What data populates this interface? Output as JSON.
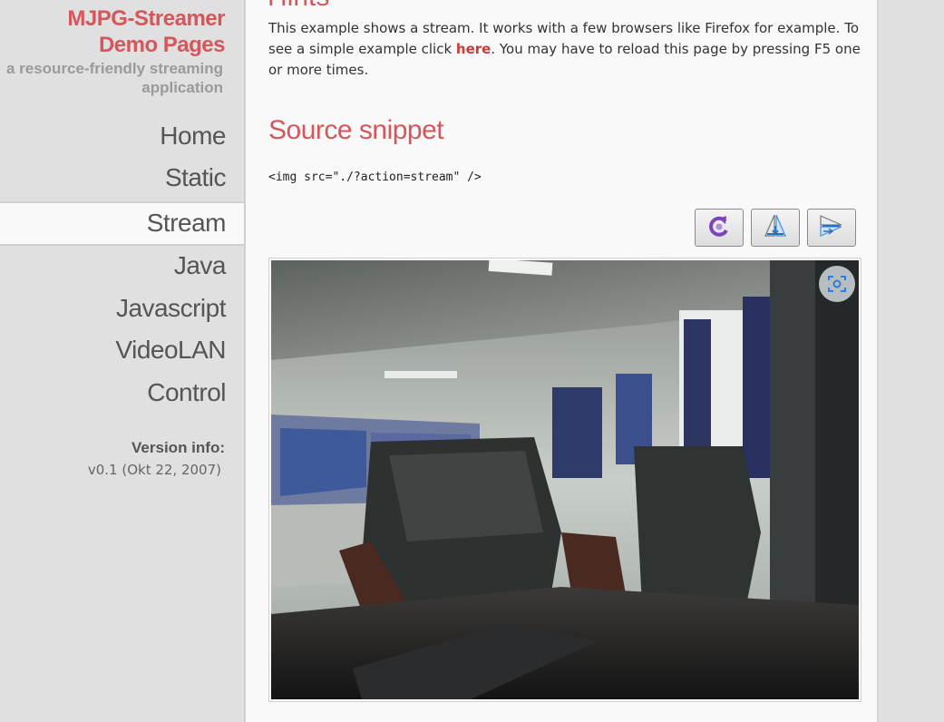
{
  "sidebar": {
    "title_line1": "MJPG-Streamer",
    "title_line2": "Demo Pages",
    "subtitle_line1": "a resource-friendly streaming",
    "subtitle_line2": "application",
    "nav": [
      {
        "label": "Home",
        "active": false
      },
      {
        "label": "Static",
        "active": false
      },
      {
        "label": "Stream",
        "active": true
      },
      {
        "label": "Java",
        "active": false
      },
      {
        "label": "Javascript",
        "active": false
      },
      {
        "label": "VideoLAN",
        "active": false
      },
      {
        "label": "Control",
        "active": false
      }
    ],
    "version_label": "Version info:",
    "version_value": "v0.1 (Okt 22, 2007)"
  },
  "main": {
    "hints_heading": "Hints",
    "intro_before": "This example shows a stream. It works with a few browsers like Firefox for example. To see a simple example click ",
    "intro_link": "here",
    "intro_after": ". You may have to reload this page by pressing F5 one or more times.",
    "source_heading": "Source snippet",
    "code_snippet": "<img src=\"./?action=stream\" />",
    "toolbar": [
      {
        "icon": "rotate-icon"
      },
      {
        "icon": "flip-vertical-icon"
      },
      {
        "icon": "flip-horizontal-icon"
      }
    ],
    "stream_image": {
      "icon": "screenshot-icon"
    }
  },
  "colors": {
    "accent": "#d5565b",
    "link": "#c43c3c",
    "sidebar_bg": "#e0e0e0",
    "main_bg": "#f9f9f9"
  }
}
